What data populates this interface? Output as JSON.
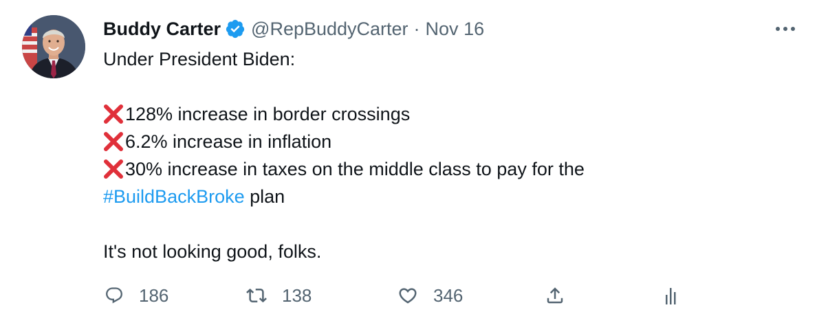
{
  "tweet": {
    "author": {
      "display_name": "Buddy Carter",
      "handle": "@RepBuddyCarter",
      "verified": true
    },
    "separator": "·",
    "date": "Nov 16",
    "lines": {
      "intro": "Under President Biden:",
      "item1": "128% increase in border crossings",
      "item2": "6.2% increase in inflation",
      "item3": "30% increase in taxes on the middle class to pay for the",
      "hashtag": "#BuildBackBroke",
      "hashtag_suffix": " plan",
      "closing": "It's not looking good, folks."
    },
    "emoji": "cross-mark",
    "stats": {
      "replies": "186",
      "retweets": "138",
      "likes": "346"
    },
    "colors": {
      "text": "#0f1419",
      "secondary": "#536471",
      "link": "#1d9bf0",
      "verified": "#1d9bf0",
      "cross": "#e0303a"
    },
    "icons": [
      "avatar",
      "verified-badge-icon",
      "more-icon",
      "cross-mark-icon",
      "reply-icon",
      "retweet-icon",
      "like-icon",
      "share-icon",
      "analytics-icon"
    ]
  }
}
